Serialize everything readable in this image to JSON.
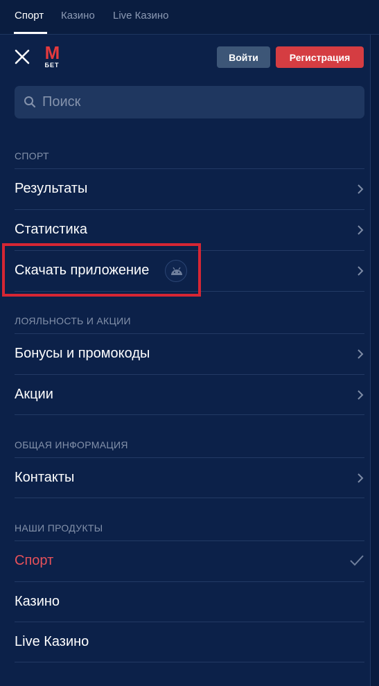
{
  "top_tabs": [
    {
      "label": "Спорт",
      "active": true
    },
    {
      "label": "Казино",
      "active": false
    },
    {
      "label": "Live Казино",
      "active": false
    }
  ],
  "header": {
    "logo_top": "M",
    "logo_bottom": "БЕТ",
    "login_label": "Войти",
    "register_label": "Регистрация"
  },
  "search": {
    "placeholder": "Поиск",
    "icon": "search-icon"
  },
  "sections": {
    "sport": "СПОРТ",
    "loyalty": "ЛОЯЛЬНОСТЬ И АКЦИИ",
    "info": "ОБЩАЯ ИНФОРМАЦИЯ",
    "products": "НАШИ ПРОДУКТЫ"
  },
  "menu": {
    "results": "Результаты",
    "statistics": "Статистика",
    "download_app": "Скачать приложение",
    "bonuses": "Бонусы и промокоды",
    "promotions": "Акции",
    "contacts": "Контакты",
    "product_sport": "Спорт",
    "product_casino": "Казино",
    "product_live_casino": "Live Казино"
  },
  "colors": {
    "background": "#0c2149",
    "accent_red": "#d53d42",
    "highlight_red": "#d62634",
    "login_button": "#3d5677",
    "active_product": "#e7515a"
  }
}
